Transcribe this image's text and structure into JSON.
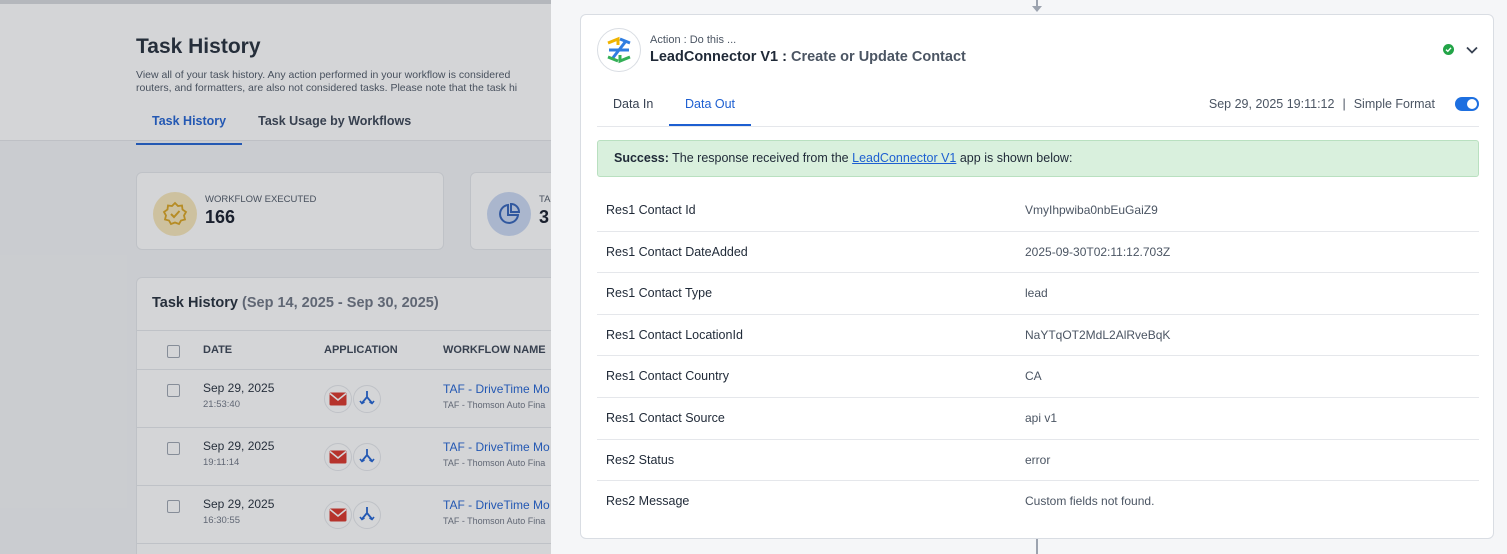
{
  "background": {
    "page_title": "Task History",
    "description_line1": "View all of your task history. Any action performed in your workflow is considered",
    "description_line2": "routers, and formatters, are also not considered tasks. Please note that the task hi",
    "tabs": [
      "Task History",
      "Task Usage by Workflows"
    ],
    "stats": [
      {
        "label": "WORKFLOW EXECUTED",
        "value": "166",
        "icon": "badge-check-icon"
      },
      {
        "label": "TA",
        "value": "3",
        "icon": "pie-chart-icon"
      }
    ],
    "history": {
      "title": "Task History",
      "range": "(Sep 14, 2025 - Sep 30, 2025)",
      "columns": [
        "DATE",
        "APPLICATION",
        "WORKFLOW NAME"
      ],
      "rows": [
        {
          "date": "Sep 29, 2025",
          "time": "21:53:40",
          "workflow": "TAF - DriveTime Mo",
          "workflow_sub": "TAF - Thomson Auto Fina"
        },
        {
          "date": "Sep 29, 2025",
          "time": "19:11:14",
          "workflow": "TAF - DriveTime Mo",
          "workflow_sub": "TAF - Thomson Auto Fina"
        },
        {
          "date": "Sep 29, 2025",
          "time": "16:30:55",
          "workflow": "TAF - DriveTime Mo",
          "workflow_sub": "TAF - Thomson Auto Fina"
        }
      ]
    }
  },
  "step": {
    "kicker": "Action : Do this ...",
    "app_name": "LeadConnector V1 :",
    "action_name": "Create or Update Contact",
    "tabs": [
      "Data In",
      "Data Out"
    ],
    "active_tab": "Data Out",
    "timestamp": "Sep 29, 2025 19:11:12",
    "separator": "|",
    "format_label": "Simple Format",
    "simple_format_on": true,
    "success": {
      "label": "Success:",
      "text_before": "The response received from the",
      "link": "LeadConnector V1",
      "text_after": "app is shown below:"
    },
    "fields": [
      {
        "key": "Res1 Contact Id",
        "value": "VmyIhpwiba0nbEuGaiZ9"
      },
      {
        "key": "Res1 Contact DateAdded",
        "value": "2025-09-30T02:11:12.703Z"
      },
      {
        "key": "Res1 Contact Type",
        "value": "lead"
      },
      {
        "key": "Res1 Contact LocationId",
        "value": "NaYTqOT2MdL2AlRveBqK"
      },
      {
        "key": "Res1 Contact Country",
        "value": "CA"
      },
      {
        "key": "Res1 Contact Source",
        "value": "api v1"
      },
      {
        "key": "Res2 Status",
        "value": "error"
      },
      {
        "key": "Res2 Message",
        "value": "Custom fields not found."
      }
    ]
  },
  "colors": {
    "accent": "#1d5fd1",
    "success_bg": "#d9f0dd",
    "status_green": "#22a447",
    "gmail_red": "#d93025"
  }
}
